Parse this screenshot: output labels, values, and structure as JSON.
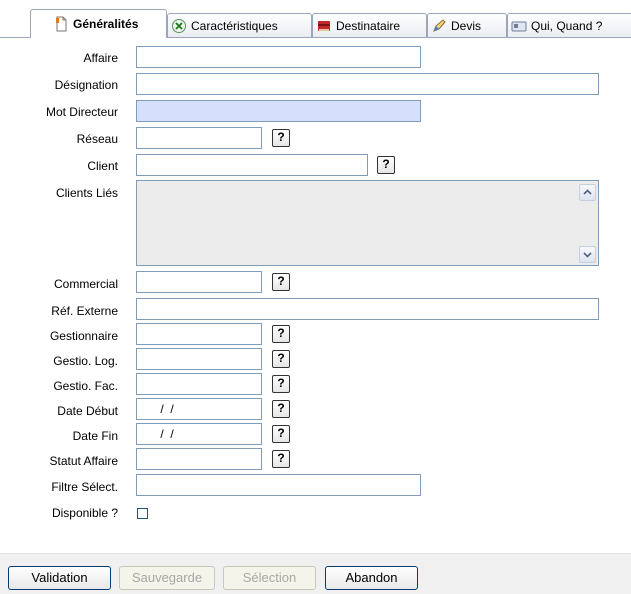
{
  "tabs": [
    {
      "label": "Généralités",
      "icon": "document-icon",
      "active": true
    },
    {
      "label": "Caractéristiques",
      "icon": "excel-icon",
      "active": false
    },
    {
      "label": "Destinataire",
      "icon": "books-icon",
      "active": false
    },
    {
      "label": "Devis",
      "icon": "pen-icon",
      "active": false
    },
    {
      "label": "Qui, Quand ?",
      "icon": "card-icon",
      "active": false
    }
  ],
  "form": {
    "affaire": {
      "label": "Affaire",
      "value": ""
    },
    "designation": {
      "label": "Désignation",
      "value": ""
    },
    "mot_directeur": {
      "label": "Mot Directeur",
      "value": ""
    },
    "reseau": {
      "label": "Réseau",
      "value": ""
    },
    "client": {
      "label": "Client",
      "value": ""
    },
    "clients_lies": {
      "label": "Clients Liés",
      "value": ""
    },
    "commercial": {
      "label": "Commercial",
      "value": ""
    },
    "ref_externe": {
      "label": "Réf. Externe",
      "value": ""
    },
    "gestionnaire": {
      "label": "Gestionnaire",
      "value": ""
    },
    "gestio_log": {
      "label": "Gestio. Log.",
      "value": ""
    },
    "gestio_fac": {
      "label": "Gestio. Fac.",
      "value": ""
    },
    "date_debut": {
      "label": "Date Début",
      "value": " /  /"
    },
    "date_fin": {
      "label": "Date Fin",
      "value": " /  /"
    },
    "statut_affaire": {
      "label": "Statut Affaire",
      "value": ""
    },
    "filtre_select": {
      "label": "Filtre Sélect.",
      "value": ""
    },
    "disponible": {
      "label": "Disponible ?",
      "checked": false
    }
  },
  "lookup_label": "?",
  "buttons": {
    "validation": "Validation",
    "sauvegarde": "Sauvegarde",
    "selection": "Sélection",
    "abandon": "Abandon"
  },
  "colors": {
    "highlight_field": "#d6dffb",
    "field_border": "#7f9db9",
    "button_border": "#003c74"
  }
}
